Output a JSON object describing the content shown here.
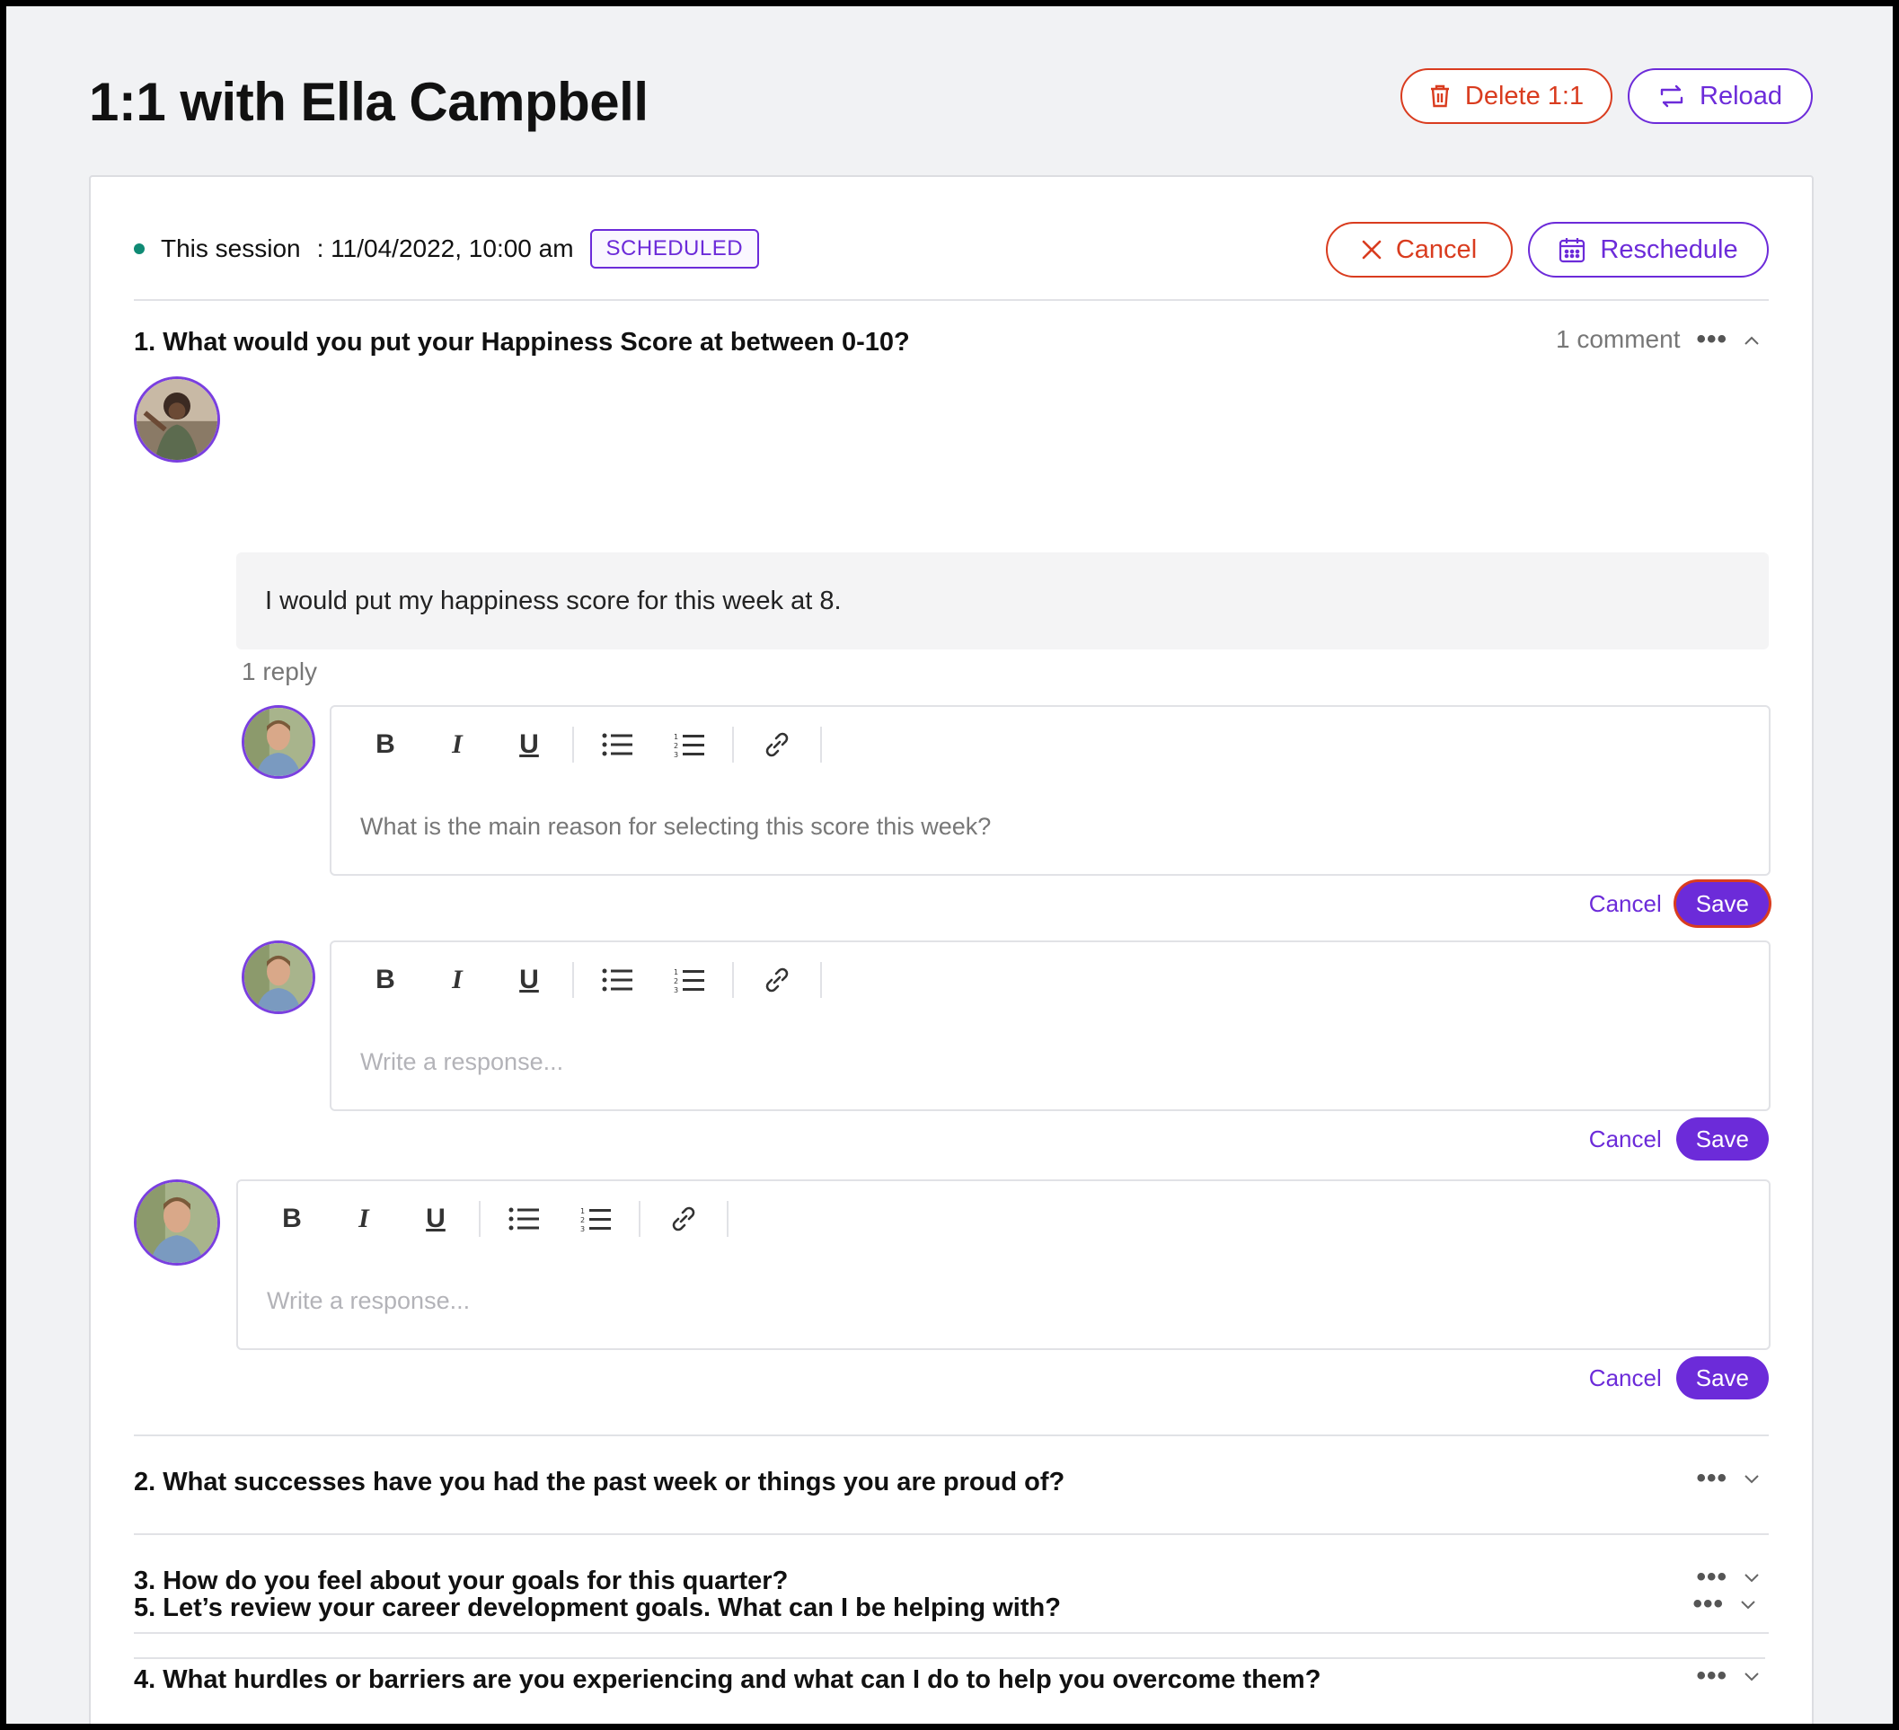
{
  "page": {
    "title": "1:1 with Ella Campbell",
    "delete_label": "Delete 1:1",
    "reload_label": "Reload"
  },
  "session": {
    "label": "This session",
    "datetime": ": 11/04/2022, 10:00 am",
    "status": "SCHEDULED",
    "cancel_label": "Cancel",
    "reschedule_label": "Reschedule"
  },
  "questions": [
    {
      "title": "1. What would you put your Happiness Score at between 0-10?",
      "comment_count": "1 comment",
      "comment_text": "I would put my happiness score for this week at 8.",
      "reply_count": "1 reply",
      "reply_text": "What is the main reason for selecting this score this week?",
      "response_placeholder": "Write a response...",
      "new_response_placeholder": "Write a response..."
    },
    {
      "title": "2. What successes have you had the past week or things you are proud of?"
    },
    {
      "title": "3. How do you feel about your goals for this quarter?"
    },
    {
      "title": "4. What hurdles or barriers are you experiencing and what can I do to help you overcome them?"
    },
    {
      "title": "5. Let’s review your career development goals. What can I be helping with?"
    }
  ],
  "editor": {
    "bold": "B",
    "italic": "I",
    "underline": "U",
    "cancel_label": "Cancel",
    "save_label": "Save"
  },
  "colors": {
    "accent": "#6c2bd9",
    "danger": "#d93c1f",
    "status_dot": "#0f8a74"
  }
}
